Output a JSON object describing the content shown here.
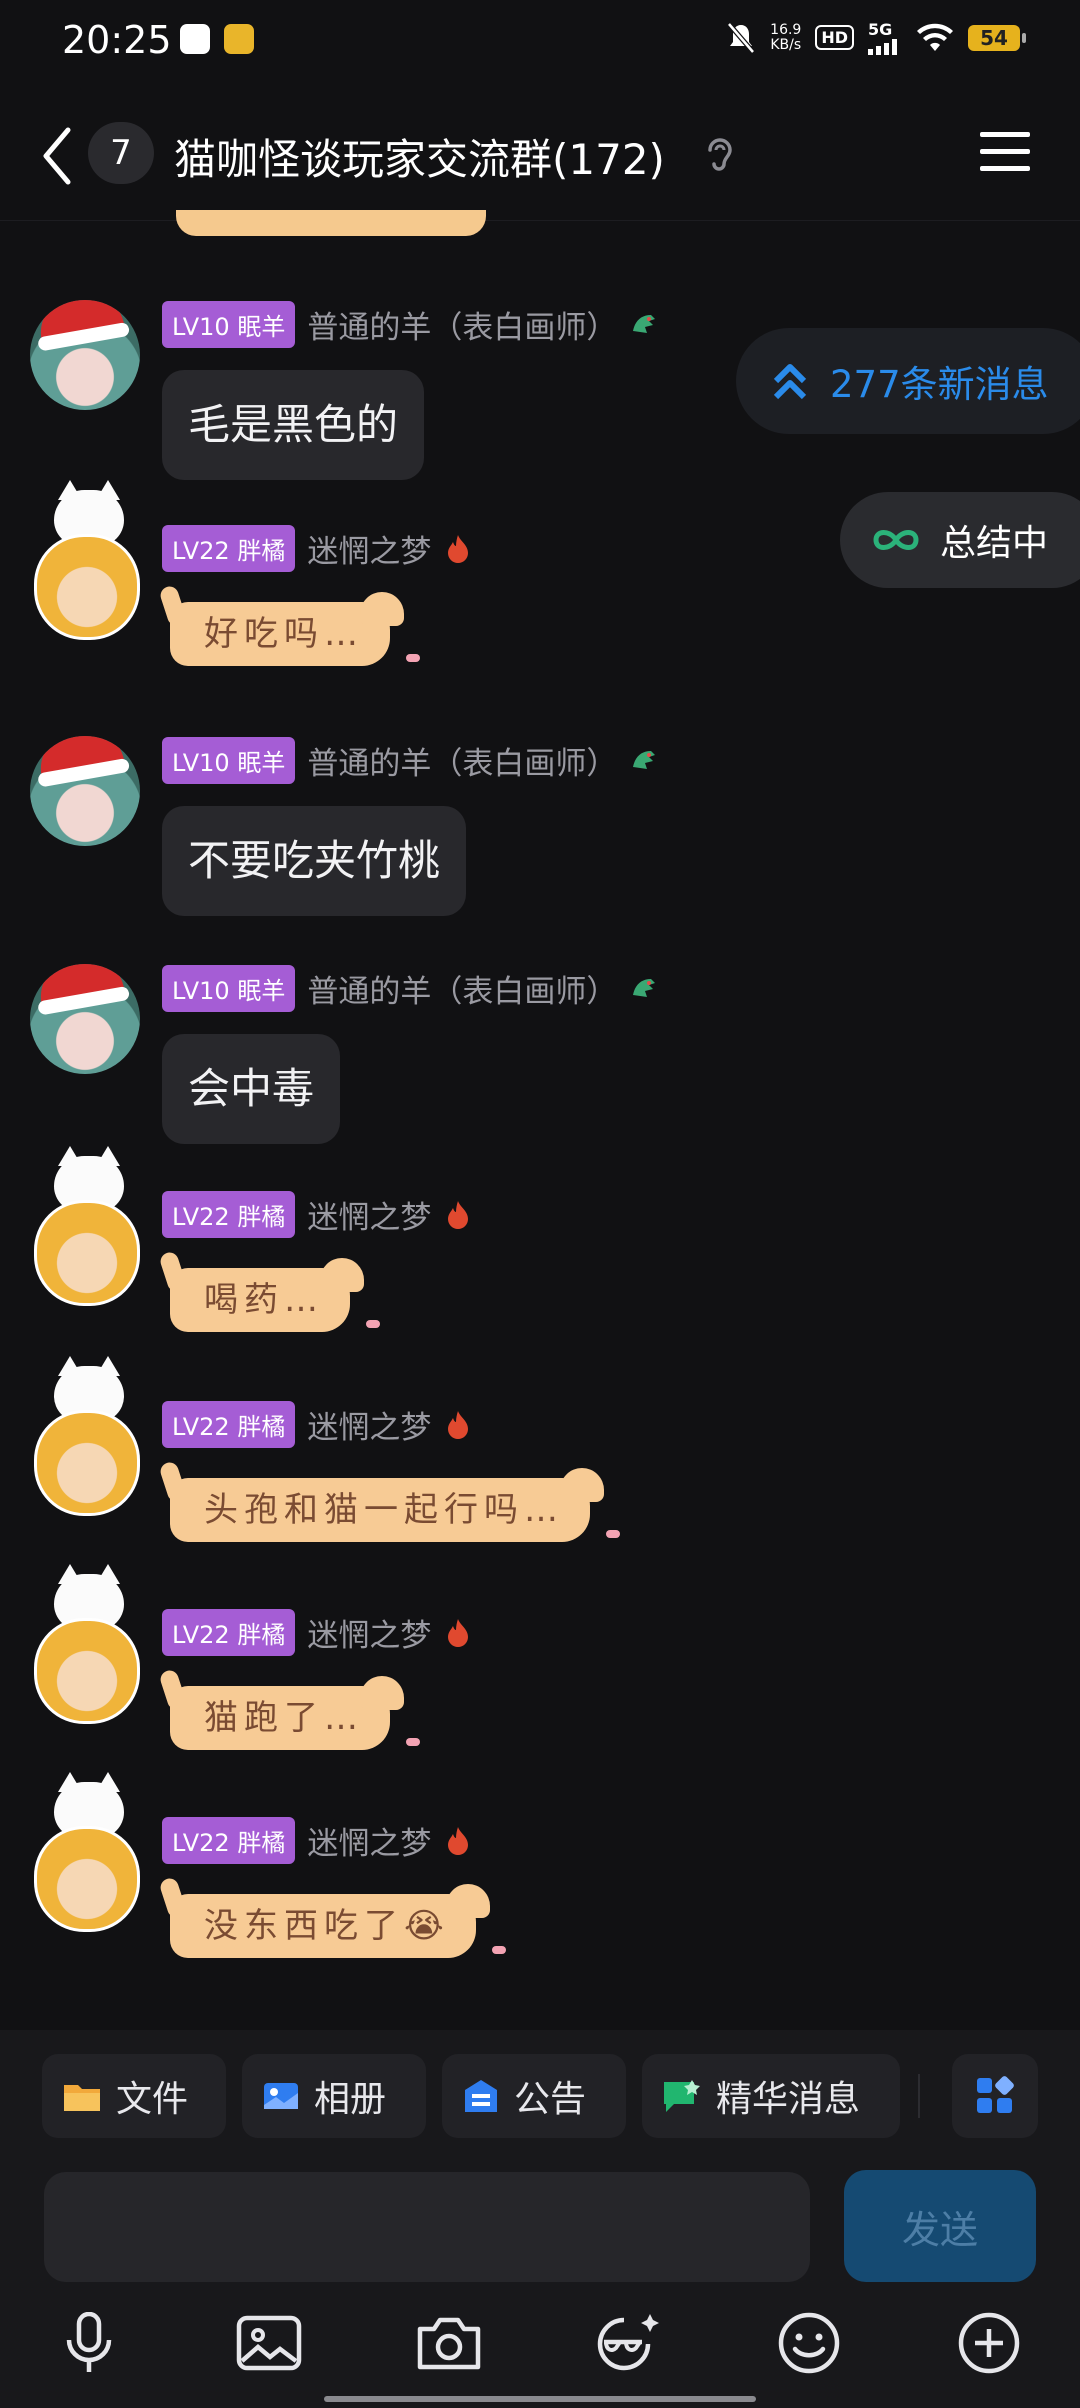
{
  "status_bar": {
    "time": "20:25",
    "net_speed_value": "16.9",
    "net_speed_unit": "KB/s",
    "hd": "HD",
    "signal": "5G",
    "battery": "54"
  },
  "header": {
    "unread_count": "7",
    "title": "猫咖怪谈玩家交流群(172)"
  },
  "floating": {
    "new_messages": "277条新消息",
    "summarizing": "总结中"
  },
  "messages": [
    {
      "level": "LV10 眠羊",
      "name": "普通的羊（表白画师）",
      "text": "毛是黑色的",
      "kind": "text"
    },
    {
      "level": "LV22 胖橘",
      "name": "迷惘之梦",
      "text": "好吃吗…",
      "kind": "sticker"
    },
    {
      "level": "LV10 眠羊",
      "name": "普通的羊（表白画师）",
      "text": "不要吃夹竹桃",
      "kind": "text"
    },
    {
      "level": "LV10 眠羊",
      "name": "普通的羊（表白画师）",
      "text": "会中毒",
      "kind": "text"
    },
    {
      "level": "LV22 胖橘",
      "name": "迷惘之梦",
      "text": "喝药…",
      "kind": "sticker"
    },
    {
      "level": "LV22 胖橘",
      "name": "迷惘之梦",
      "text": "头孢和猫一起行吗…",
      "kind": "sticker"
    },
    {
      "level": "LV22 胖橘",
      "name": "迷惘之梦",
      "text": "猫跑了…",
      "kind": "sticker"
    },
    {
      "level": "LV22 胖橘",
      "name": "迷惘之梦",
      "text": "没东西吃了😭",
      "kind": "sticker"
    }
  ],
  "chips": [
    "文件",
    "相册",
    "公告",
    "精华消息"
  ],
  "input": {
    "value": "",
    "placeholder": ""
  },
  "send_label": "发送",
  "toolbar_icons": [
    "microphone-icon",
    "image-icon",
    "camera-icon",
    "magic-glasses-icon",
    "emoji-icon",
    "plus-icon"
  ],
  "colors": {
    "background": "#111113",
    "level_badge": "#a55dd5",
    "accent_blue": "#2a8bea",
    "send_button": "#154a72"
  }
}
